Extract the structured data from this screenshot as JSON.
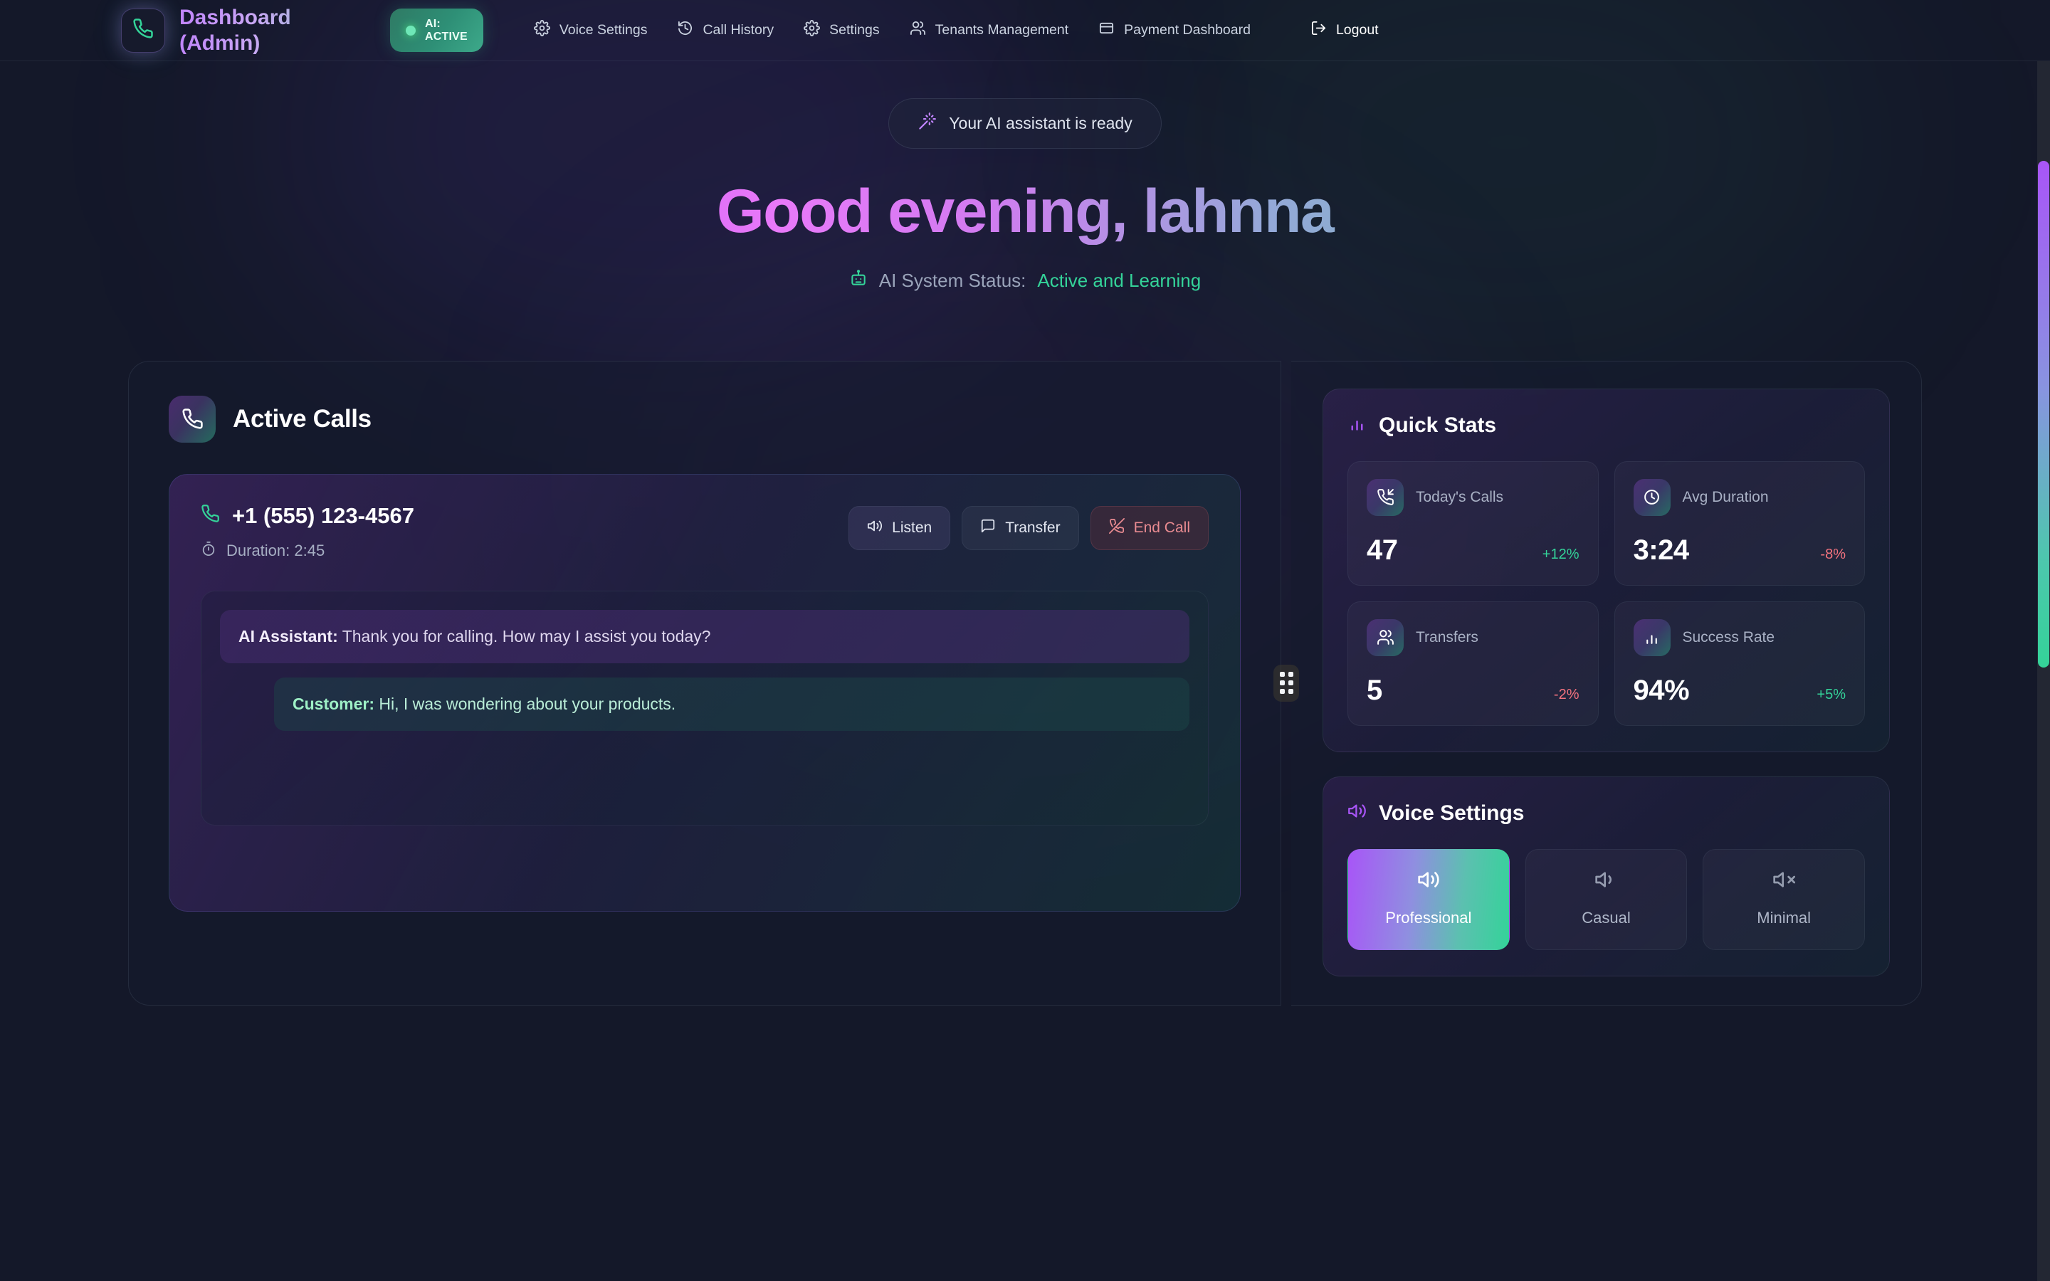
{
  "nav": {
    "brand_title": "Dashboard (Admin)",
    "brand_icon": "phone-icon",
    "ai_chip_line1": "AI:",
    "ai_chip_line2": "ACTIVE",
    "links": [
      {
        "label": "Voice Settings",
        "icon": "gear-icon"
      },
      {
        "label": "Call History",
        "icon": "history-icon"
      },
      {
        "label": "Settings",
        "icon": "gear-icon"
      },
      {
        "label": "Tenants Management",
        "icon": "users-icon"
      },
      {
        "label": "Payment Dashboard",
        "icon": "credit-card-icon"
      }
    ],
    "logout_label": "Logout",
    "logout_icon": "logout-icon"
  },
  "hero": {
    "badge_text": "Your AI assistant is ready",
    "badge_icon": "magic-wand-icon",
    "title": "Good evening, lahnna",
    "status_icon": "robot-icon",
    "status_label": "AI System Status:",
    "status_value": "Active and Learning"
  },
  "active_calls": {
    "title": "Active Calls",
    "icon": "phone-icon",
    "call": {
      "number": "+1 (555) 123-4567",
      "number_icon": "phone-icon",
      "duration": "Duration: 2:45",
      "duration_icon": "timer-icon",
      "actions": [
        {
          "label": "Listen",
          "icon": "volume-icon",
          "style": "default"
        },
        {
          "label": "Transfer",
          "icon": "message-icon",
          "style": "ghost"
        },
        {
          "label": "End Call",
          "icon": "phone-off-icon",
          "style": "danger"
        }
      ],
      "transcript": [
        {
          "speaker": "AI Assistant:",
          "text": " Thank you for calling. How may I assist you today?",
          "role": "ai"
        },
        {
          "speaker": "Customer:",
          "text": " Hi, I was wondering about your products.",
          "role": "customer"
        }
      ]
    }
  },
  "quick_stats": {
    "title": "Quick Stats",
    "icon": "bar-chart-icon",
    "items": [
      {
        "label": "Today's Calls",
        "value": "47",
        "delta": "+12%",
        "trend": "up",
        "icon": "phone-incoming-icon"
      },
      {
        "label": "Avg Duration",
        "value": "3:24",
        "delta": "-8%",
        "trend": "down",
        "icon": "clock-icon"
      },
      {
        "label": "Transfers",
        "value": "5",
        "delta": "-2%",
        "trend": "down",
        "icon": "users-icon"
      },
      {
        "label": "Success Rate",
        "value": "94%",
        "delta": "+5%",
        "trend": "up",
        "icon": "bar-chart-icon"
      }
    ]
  },
  "voice_settings": {
    "title": "Voice Settings",
    "icon": "volume-icon",
    "options": [
      {
        "label": "Professional",
        "icon": "volume-high-icon",
        "active": true
      },
      {
        "label": "Casual",
        "icon": "volume-low-icon",
        "active": false
      },
      {
        "label": "Minimal",
        "icon": "volume-mute-icon",
        "active": false
      }
    ]
  },
  "colors": {
    "accent_purple": "#a855f7",
    "accent_green": "#34d399",
    "danger_red": "#f4737f",
    "background": "#141829"
  }
}
